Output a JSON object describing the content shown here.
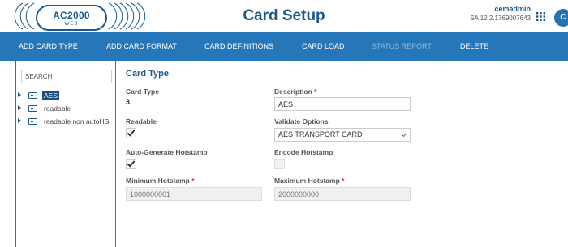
{
  "header": {
    "logo_main": "AC2000",
    "logo_sub": "WEB",
    "title": "Card Setup",
    "username": "cemadmin",
    "version": "SA 12.2.1769007643",
    "apps_icon": "grid-icon",
    "avatar_initial": "C",
    "accent_color": "#1c5a8e"
  },
  "nav": {
    "items": [
      {
        "label": "ADD CARD TYPE",
        "enabled": true
      },
      {
        "label": "ADD CARD FORMAT",
        "enabled": true
      },
      {
        "label": "CARD DEFINITIONS",
        "enabled": true
      },
      {
        "label": "CARD LOAD",
        "enabled": true
      },
      {
        "label": "STATUS REPORT",
        "enabled": false
      },
      {
        "label": "DELETE",
        "enabled": true
      }
    ],
    "background": "#2677b9"
  },
  "sidebar": {
    "search_placeholder": "SEARCH",
    "items": [
      {
        "label": "AES",
        "selected": true,
        "icon": "card-icon"
      },
      {
        "label": "roadable",
        "selected": false,
        "icon": "card-icon"
      },
      {
        "label": "readable non autoHS",
        "selected": false,
        "icon": "card-icon"
      }
    ]
  },
  "form": {
    "section_title": "Card Type",
    "card_type_label": "Card Type",
    "card_type_value": "3",
    "description_label": "Description",
    "description_value": "AES",
    "readable_label": "Readable",
    "readable_checked": true,
    "validate_label": "Validate Options",
    "validate_value": "AES TRANSPORT CARD",
    "autogen_label": "Auto-Generate Hotstamp",
    "autogen_checked": true,
    "encode_label": "Encode Hotstamp",
    "encode_checked": false,
    "min_label": "Minimum Hotstamp",
    "min_value": "1000000001",
    "max_label": "Maximum Hotstamp",
    "max_value": "2000000000",
    "required_marker": "*"
  }
}
